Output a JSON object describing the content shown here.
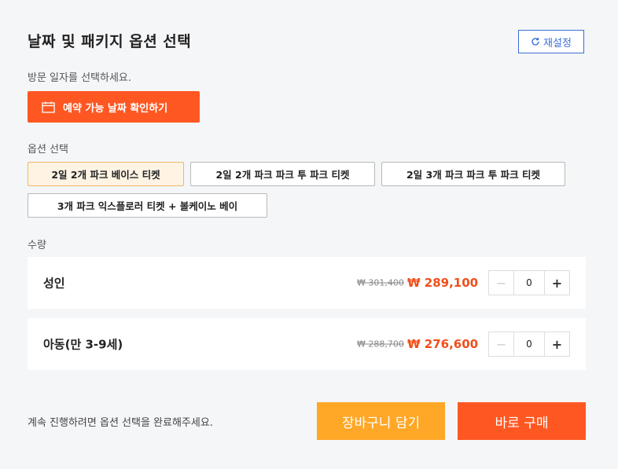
{
  "header": {
    "title": "날짜 및 패키지 옵션 선택",
    "reset_label": "재설정"
  },
  "date": {
    "instruction": "방문 일자를 선택하세요.",
    "button_label": "예약 가능 날짜 확인하기"
  },
  "options": {
    "label": "옵션 선택",
    "items": [
      {
        "label": "2일 2개 파크 베이스 티켓",
        "selected": true
      },
      {
        "label": "2일 2개 파크 파크 투 파크 티켓",
        "selected": false
      },
      {
        "label": "2일 3개 파크 파크 투 파크 티켓",
        "selected": false
      },
      {
        "label": "3개 파크 익스플로러 티켓 + 볼케이노 베이",
        "selected": false
      }
    ]
  },
  "quantity": {
    "label": "수량",
    "rows": [
      {
        "label": "성인",
        "original_price": "₩ 301,400",
        "price": "₩ 289,100",
        "qty": "0"
      },
      {
        "label": "아동(만 3-9세)",
        "original_price": "₩ 288,700",
        "price": "₩ 276,600",
        "qty": "0"
      }
    ]
  },
  "footer": {
    "note": "계속 진행하려면 옵션 선택을 완료해주세요.",
    "cart_label": "장바구니 담기",
    "buy_label": "바로 구매"
  },
  "colors": {
    "accent": "#ff5722",
    "cart": "#ffa726",
    "price": "#f04e1a",
    "reset": "#3b6fd8"
  },
  "icons": {
    "reset": "refresh-icon",
    "date": "calendar-icon",
    "minus": "minus-icon",
    "plus": "plus-icon"
  }
}
